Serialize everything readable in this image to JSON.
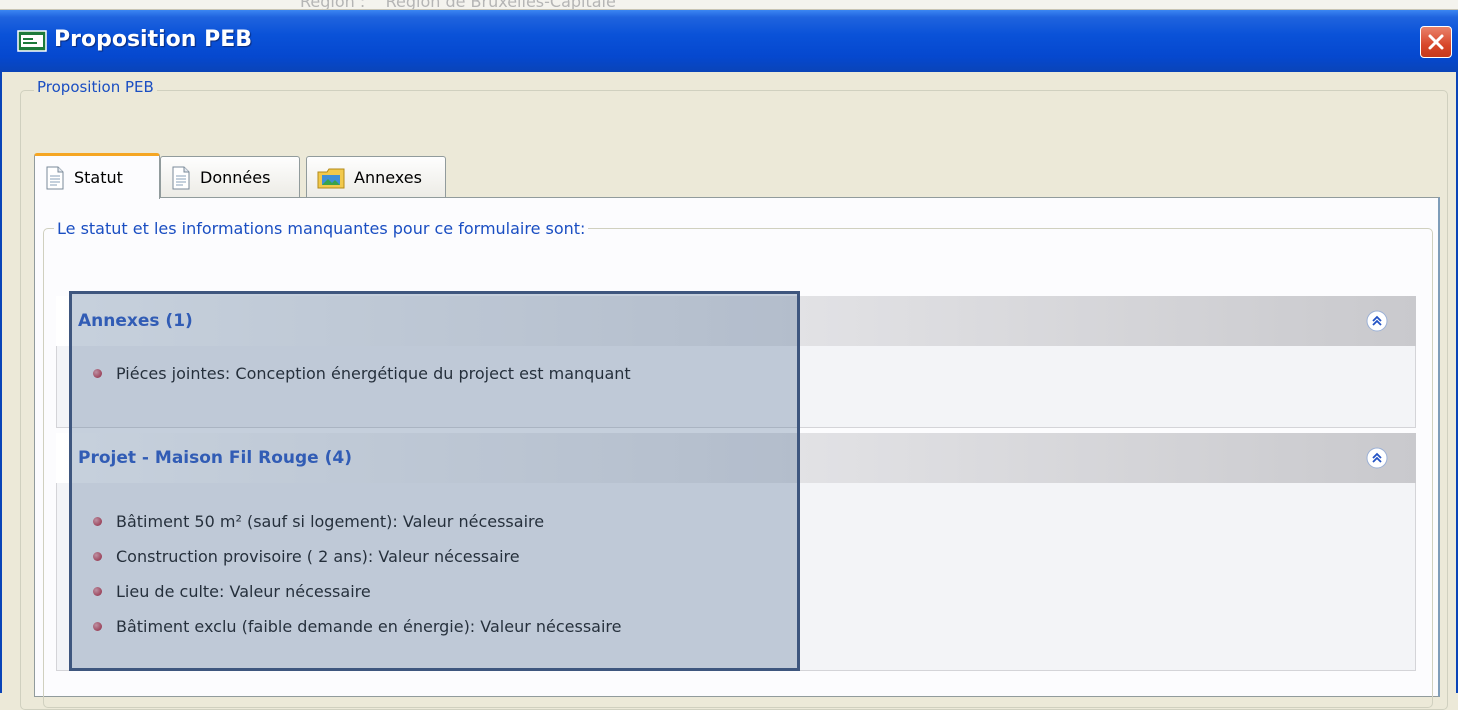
{
  "background_window": {
    "label": "Région :",
    "value": "Région de Bruxelles-Capitale"
  },
  "window": {
    "title": "Proposition PEB"
  },
  "group": {
    "label": "Proposition PEB"
  },
  "tabs": [
    {
      "label": "Statut",
      "icon": "document-icon",
      "active": true
    },
    {
      "label": "Données",
      "icon": "document-icon",
      "active": false
    },
    {
      "label": "Annexes",
      "icon": "folder-image-icon",
      "active": false
    }
  ],
  "status": {
    "group_label": "Le statut et les informations manquantes pour ce formulaire sont:",
    "sections": [
      {
        "title": "Annexes (1)",
        "items": [
          "Piéces jointes: Conception énergétique du project est manquant"
        ]
      },
      {
        "title": "Projet - Maison Fil Rouge (4)",
        "items": [
          "Bâtiment 50 m² (sauf si logement): Valeur nécessaire",
          "Construction provisoire ( 2 ans): Valeur nécessaire",
          "Lieu de culte: Valeur nécessaire",
          "Bâtiment exclu (faible demande en énergie): Valeur nécessaire"
        ]
      }
    ]
  },
  "colors": {
    "titlebar": "#0a52d8",
    "section_title": "#2353c5",
    "group_label": "#1a4ec2",
    "active_tab_accent": "#f5a623",
    "bullet": "#c53a4a",
    "highlight_border": "#3e567e"
  }
}
